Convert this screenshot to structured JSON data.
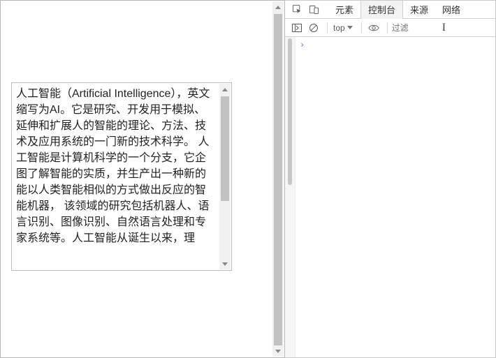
{
  "viewport": {
    "textarea_value": "人工智能（Artificial Intelligence），英文缩写为AI。它是研究、开发用于模拟、延伸和扩展人的智能的理论、方法、技术及应用系统的一门新的技术科学。 人工智能是计算机科学的一个分支，它企图了解智能的实质，并生产出一种新的能以人类智能相似的方式做出反应的智能机器， 该领域的研究包括机器人、语言识别、图像识别、自然语言处理和专家系统等。人工智能从诞生以来，理"
  },
  "devtools": {
    "tabs": [
      "元素",
      "控制台",
      "来源",
      "网络"
    ],
    "active_tab": "控制台",
    "context_label": "top",
    "filter_placeholder": "过滤",
    "prompt_symbol": "›"
  }
}
